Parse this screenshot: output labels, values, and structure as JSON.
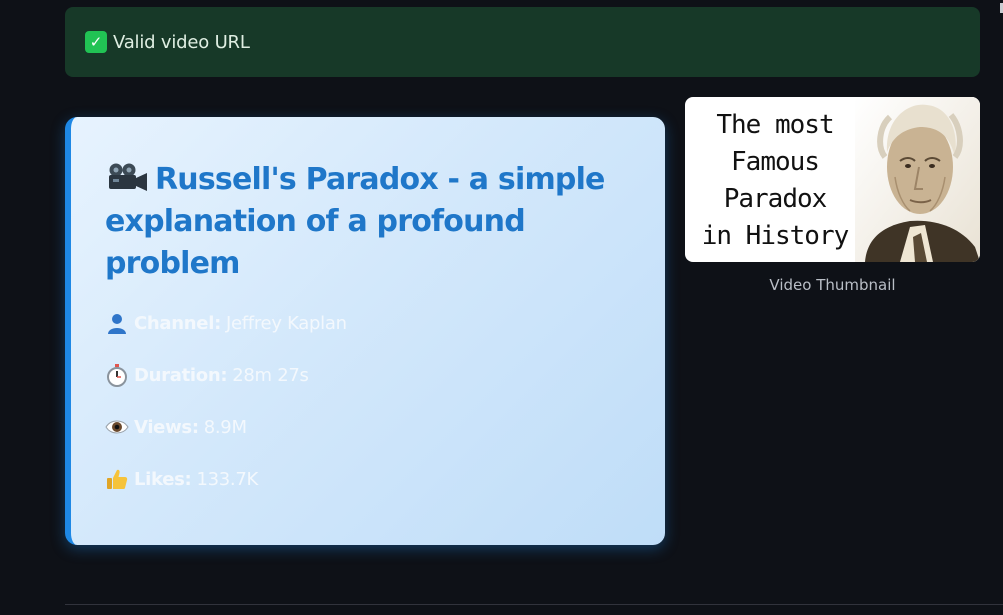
{
  "alert": {
    "icon": "check-mark-icon",
    "icon_glyph": "✓",
    "text": "Valid video URL",
    "bg_color": "#173928",
    "icon_color": "#21c354"
  },
  "video": {
    "title_icon": "movie-camera-icon",
    "title": "Russell's Paradox - a simple explanation of a profound problem",
    "accent_color": "#1e88e5",
    "details": {
      "channel": {
        "icon": "person-icon",
        "label": "Channel:",
        "value": "Jeffrey Kaplan"
      },
      "duration": {
        "icon": "stopwatch-icon",
        "label": "Duration:",
        "value": "28m 27s"
      },
      "views": {
        "icon": "eye-icon",
        "label": "Views:",
        "value": "8.9M"
      },
      "likes": {
        "icon": "thumbs-up-icon",
        "label": "Likes:",
        "value": "133.7K"
      }
    }
  },
  "thumbnail": {
    "overlay_text": "The most\nFamous\nParadox\nin History",
    "caption": "Video Thumbnail"
  }
}
